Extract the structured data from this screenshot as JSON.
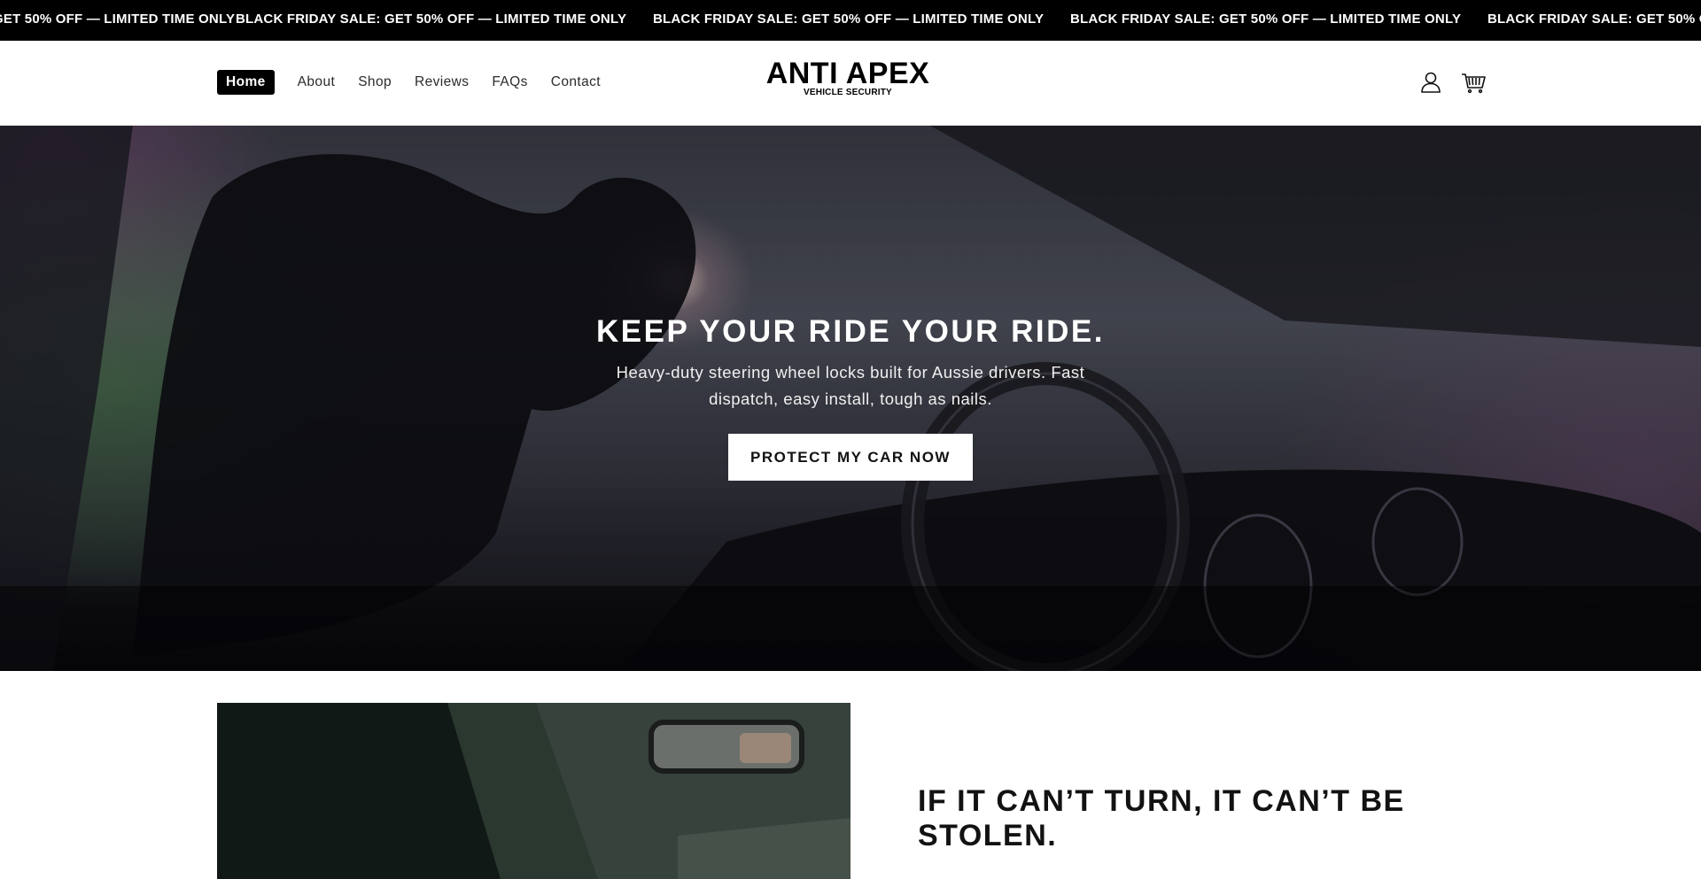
{
  "announcement": {
    "text": "BLACK FRIDAY SALE: GET 50% OFF — LIMITED TIME ONLY"
  },
  "header": {
    "nav": [
      {
        "label": "Home",
        "active": true
      },
      {
        "label": "About",
        "active": false
      },
      {
        "label": "Shop",
        "active": false
      },
      {
        "label": "Reviews",
        "active": false
      },
      {
        "label": "FAQs",
        "active": false
      },
      {
        "label": "Contact",
        "active": false
      }
    ],
    "logo": {
      "main": "ANTI APEX",
      "sub": "VEHICLE SECURITY"
    },
    "icons": [
      "account-icon",
      "cart-icon"
    ]
  },
  "hero": {
    "title": "KEEP YOUR RIDE YOUR RIDE.",
    "subtitle": "Heavy-duty steering wheel locks built for Aussie drivers. Fast dispatch, easy install, tough as nails.",
    "cta_label": "PROTECT MY CAR NOW"
  },
  "feature": {
    "title": "IF IT CAN’T TURN, IT CAN’T BE STOLEN."
  },
  "colors": {
    "announcement_bg": "#000000",
    "nav_active_bg": "#000000",
    "cta_bg": "#ffffff"
  }
}
